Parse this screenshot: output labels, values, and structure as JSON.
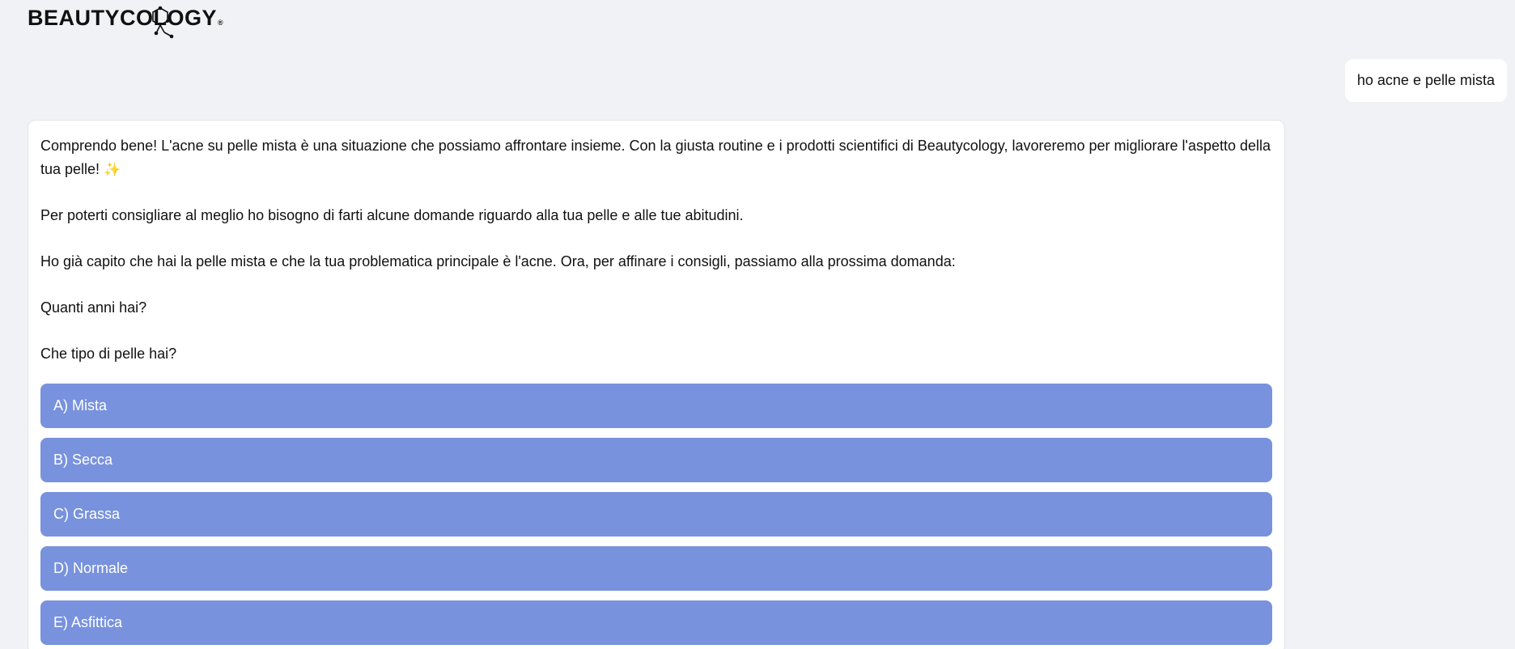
{
  "brand": {
    "logo_text": "BEAUTYCOLOGY",
    "registered_mark": "®"
  },
  "user_message": {
    "text": "ho acne e pelle mista"
  },
  "assistant_message": {
    "paragraph_1": "Comprendo bene! L'acne su pelle mista è una situazione che possiamo affrontare insieme. Con la giusta routine e i prodotti scientifici di Beautycology, lavoreremo per migliorare l'aspetto della tua pelle!",
    "sparkle": "✨",
    "paragraph_2": "Per poterti consigliare al meglio ho bisogno di farti alcune domande riguardo alla tua pelle e alle tue abitudini.",
    "paragraph_3": "Ho già capito che hai la pelle mista e che la tua problematica principale è l'acne. Ora, per affinare i consigli, passiamo alla prossima domanda:",
    "paragraph_4": "Quanti anni hai?",
    "paragraph_5": "Che tipo di pelle hai?"
  },
  "options": [
    {
      "label": "A) Mista"
    },
    {
      "label": "B) Secca"
    },
    {
      "label": "C) Grassa"
    },
    {
      "label": "D) Normale"
    },
    {
      "label": "E) Asfittica"
    }
  ],
  "colors": {
    "background": "#f1f2f5",
    "option_button": "#7892dd",
    "card": "#ffffff"
  }
}
